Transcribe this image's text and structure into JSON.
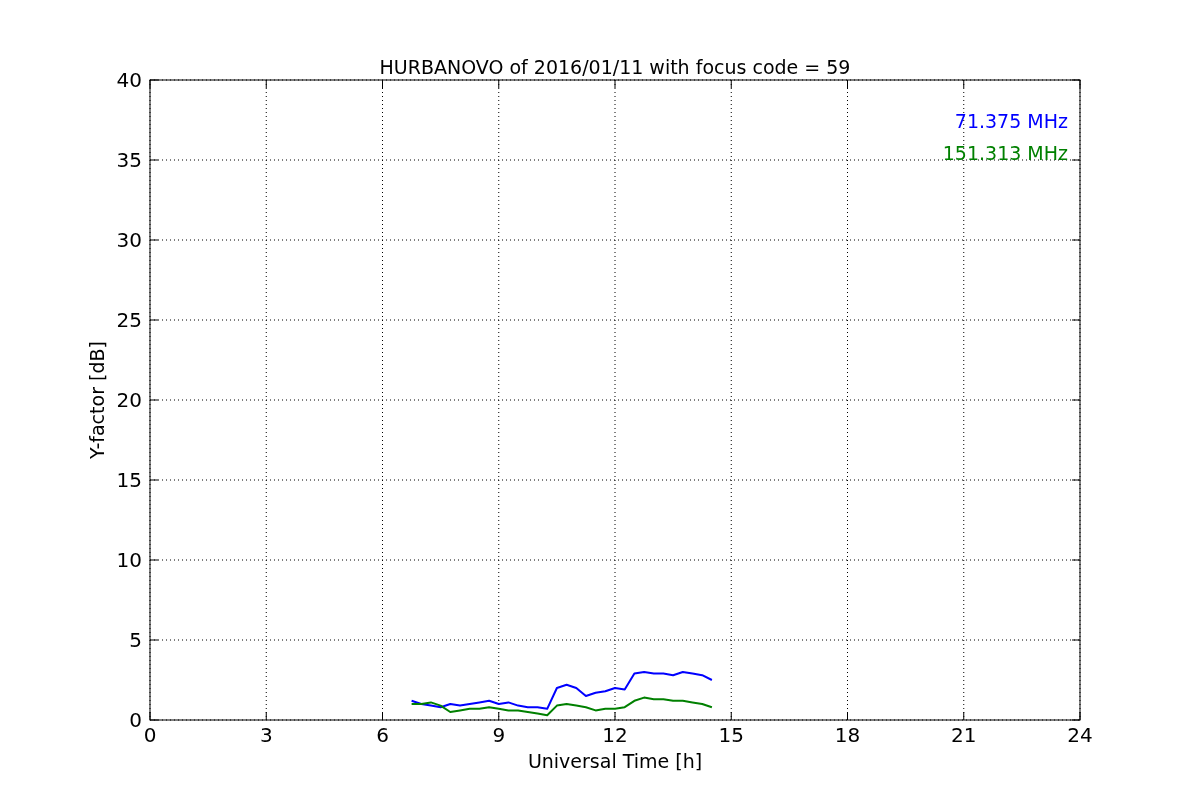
{
  "figure": {
    "chart_data": {
      "type": "line",
      "title": "HURBANOVO of 2016/01/11 with focus code = 59",
      "xlabel": "Universal Time [h]",
      "ylabel": "Y-factor [dB]",
      "x": [
        6.75,
        7,
        7.25,
        7.5,
        7.75,
        8,
        8.25,
        8.5,
        8.75,
        9,
        9.25,
        9.5,
        9.75,
        10,
        10.25,
        10.5,
        10.75,
        11,
        11.25,
        11.5,
        11.75,
        12,
        12.25,
        12.5,
        12.75,
        13,
        13.25,
        13.5,
        13.75,
        14,
        14.25,
        14.5
      ],
      "series": [
        {
          "name": "71.375 MHz",
          "color": "#0000ff",
          "values": [
            1.2,
            1.0,
            0.9,
            0.8,
            1.0,
            0.9,
            1.0,
            1.1,
            1.2,
            1.0,
            1.1,
            0.9,
            0.8,
            0.8,
            0.7,
            2.0,
            2.2,
            2.0,
            1.5,
            1.7,
            1.8,
            2.0,
            1.9,
            2.9,
            3.0,
            2.9,
            2.9,
            2.8,
            3.0,
            2.9,
            2.8,
            2.5
          ]
        },
        {
          "name": "151.313 MHz",
          "color": "#008000",
          "values": [
            1.0,
            1.0,
            1.1,
            0.9,
            0.5,
            0.6,
            0.7,
            0.7,
            0.8,
            0.7,
            0.6,
            0.6,
            0.5,
            0.4,
            0.3,
            0.9,
            1.0,
            0.9,
            0.8,
            0.6,
            0.7,
            0.7,
            0.8,
            1.2,
            1.4,
            1.3,
            1.3,
            1.2,
            1.2,
            1.1,
            1.0,
            0.8
          ]
        }
      ],
      "grid": true,
      "xlim": [
        0,
        24
      ],
      "ylim": [
        0,
        40
      ],
      "xticks": [
        0,
        3,
        6,
        9,
        12,
        15,
        18,
        21,
        24
      ],
      "yticks": [
        0,
        5,
        10,
        15,
        20,
        25,
        30,
        35,
        40
      ]
    }
  }
}
